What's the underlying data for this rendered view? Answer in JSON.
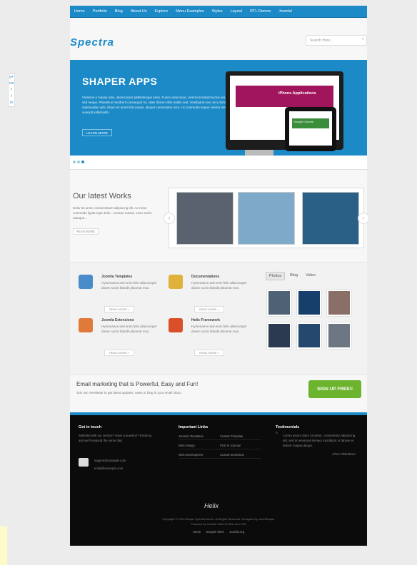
{
  "nav": [
    "Home",
    "Portfolio",
    "Blog",
    "About Us",
    "Explore",
    "Menu Examples",
    "Styles",
    "Layout",
    "RTL Demos",
    "Joomla!"
  ],
  "logo": "Spectra",
  "search": {
    "placeholder": "Search Here..."
  },
  "social": [
    "g+",
    "rss",
    "f",
    "t",
    "in"
  ],
  "hero": {
    "title": "SHAPER APPS",
    "text": "Vivamus a massa odio, ullamcorper pellentesque enim. Fusce urna lacus, viverra tincidunt luctus vel, iaculis sed neque. Phasellus hendrerit consequat mi, vitae dictum nibh mattis sed. Vestibulum nec arcu tortor, vel malesuada nulla. Etiam sit amet felis ipsum, aliquet consectetur arcu. Ut commodo neque viverra metus suscipit sollicitudin.",
    "button": "LEARN MORE",
    "screen_title": "iPhone Applications",
    "tablet_title": "Google Chrome"
  },
  "works": {
    "title": "Our latest Works",
    "text": "Dolor sit amet, consectetuer adipiscing elit. Ae nean commodo ligula eget dolor.. Aenean massa. Cum sociis natoque...",
    "button": "READ MORE"
  },
  "features": [
    {
      "title": "Joomla Templates",
      "text": "Hymenaeos sed enim felis ullamcorper donec sociis blandit placerat mus.",
      "button": "READ MORE »",
      "color": "#4a8bc9"
    },
    {
      "title": "Documentations",
      "text": "Hymenaeos sed enim felis ullamcorper donec sociis blandit placerat mus.",
      "button": "READ MORE »",
      "color": "#e0b23a"
    },
    {
      "title": "Joomla Extensions",
      "text": "Hymenaeos sed enim felis ullamcorper donec sociis blandit placerat mus.",
      "button": "READ MORE »",
      "color": "#e07a3a"
    },
    {
      "title": "Helix Framework",
      "text": "Hymenaeos sed enim felis ullamcorper donec sociis blandit placerat mus.",
      "button": "READ MORE »",
      "color": "#d94f2a"
    }
  ],
  "media_tabs": [
    "Photos",
    "Blog",
    "Video"
  ],
  "email": {
    "title": "Email marketing that is Powerful, Easy and Fun!",
    "subtitle": "Join our newsletter to get latest updates, news or blog in your email inbox.",
    "button": "SIGN UP FREE!!"
  },
  "footer": {
    "touch_title": "Get in touch",
    "touch_text": "Satisfied with our service? Have a question? Email us, and we'll respond the same day!",
    "email1": "support@example.com",
    "email2": "email@example.com",
    "links_title": "Important Links",
    "links": [
      "Joomla! Templates",
      "Custom Template",
      "Web Design",
      "PSD to Joomla!",
      "Web Development",
      "Custom Extension"
    ],
    "test_title": "Testimonials",
    "quote": "Lorem ipsum dolor sit amet, consectetur adipiscing elit, sed do eiusmod tempor incididunt ut labore et dolore magna aliqua.",
    "author": "Chris Oldenbrun",
    "helix": "Helix",
    "copyright": "Copyright © 2013 Shaper Spectra Demo. All Rights Reserved. Designed by JoomShaper",
    "powered": "Powered by Joomla! Valid XHTML and CSS",
    "bottom_links": [
      "Home",
      "Sample Sites",
      "Joomla.org"
    ]
  }
}
